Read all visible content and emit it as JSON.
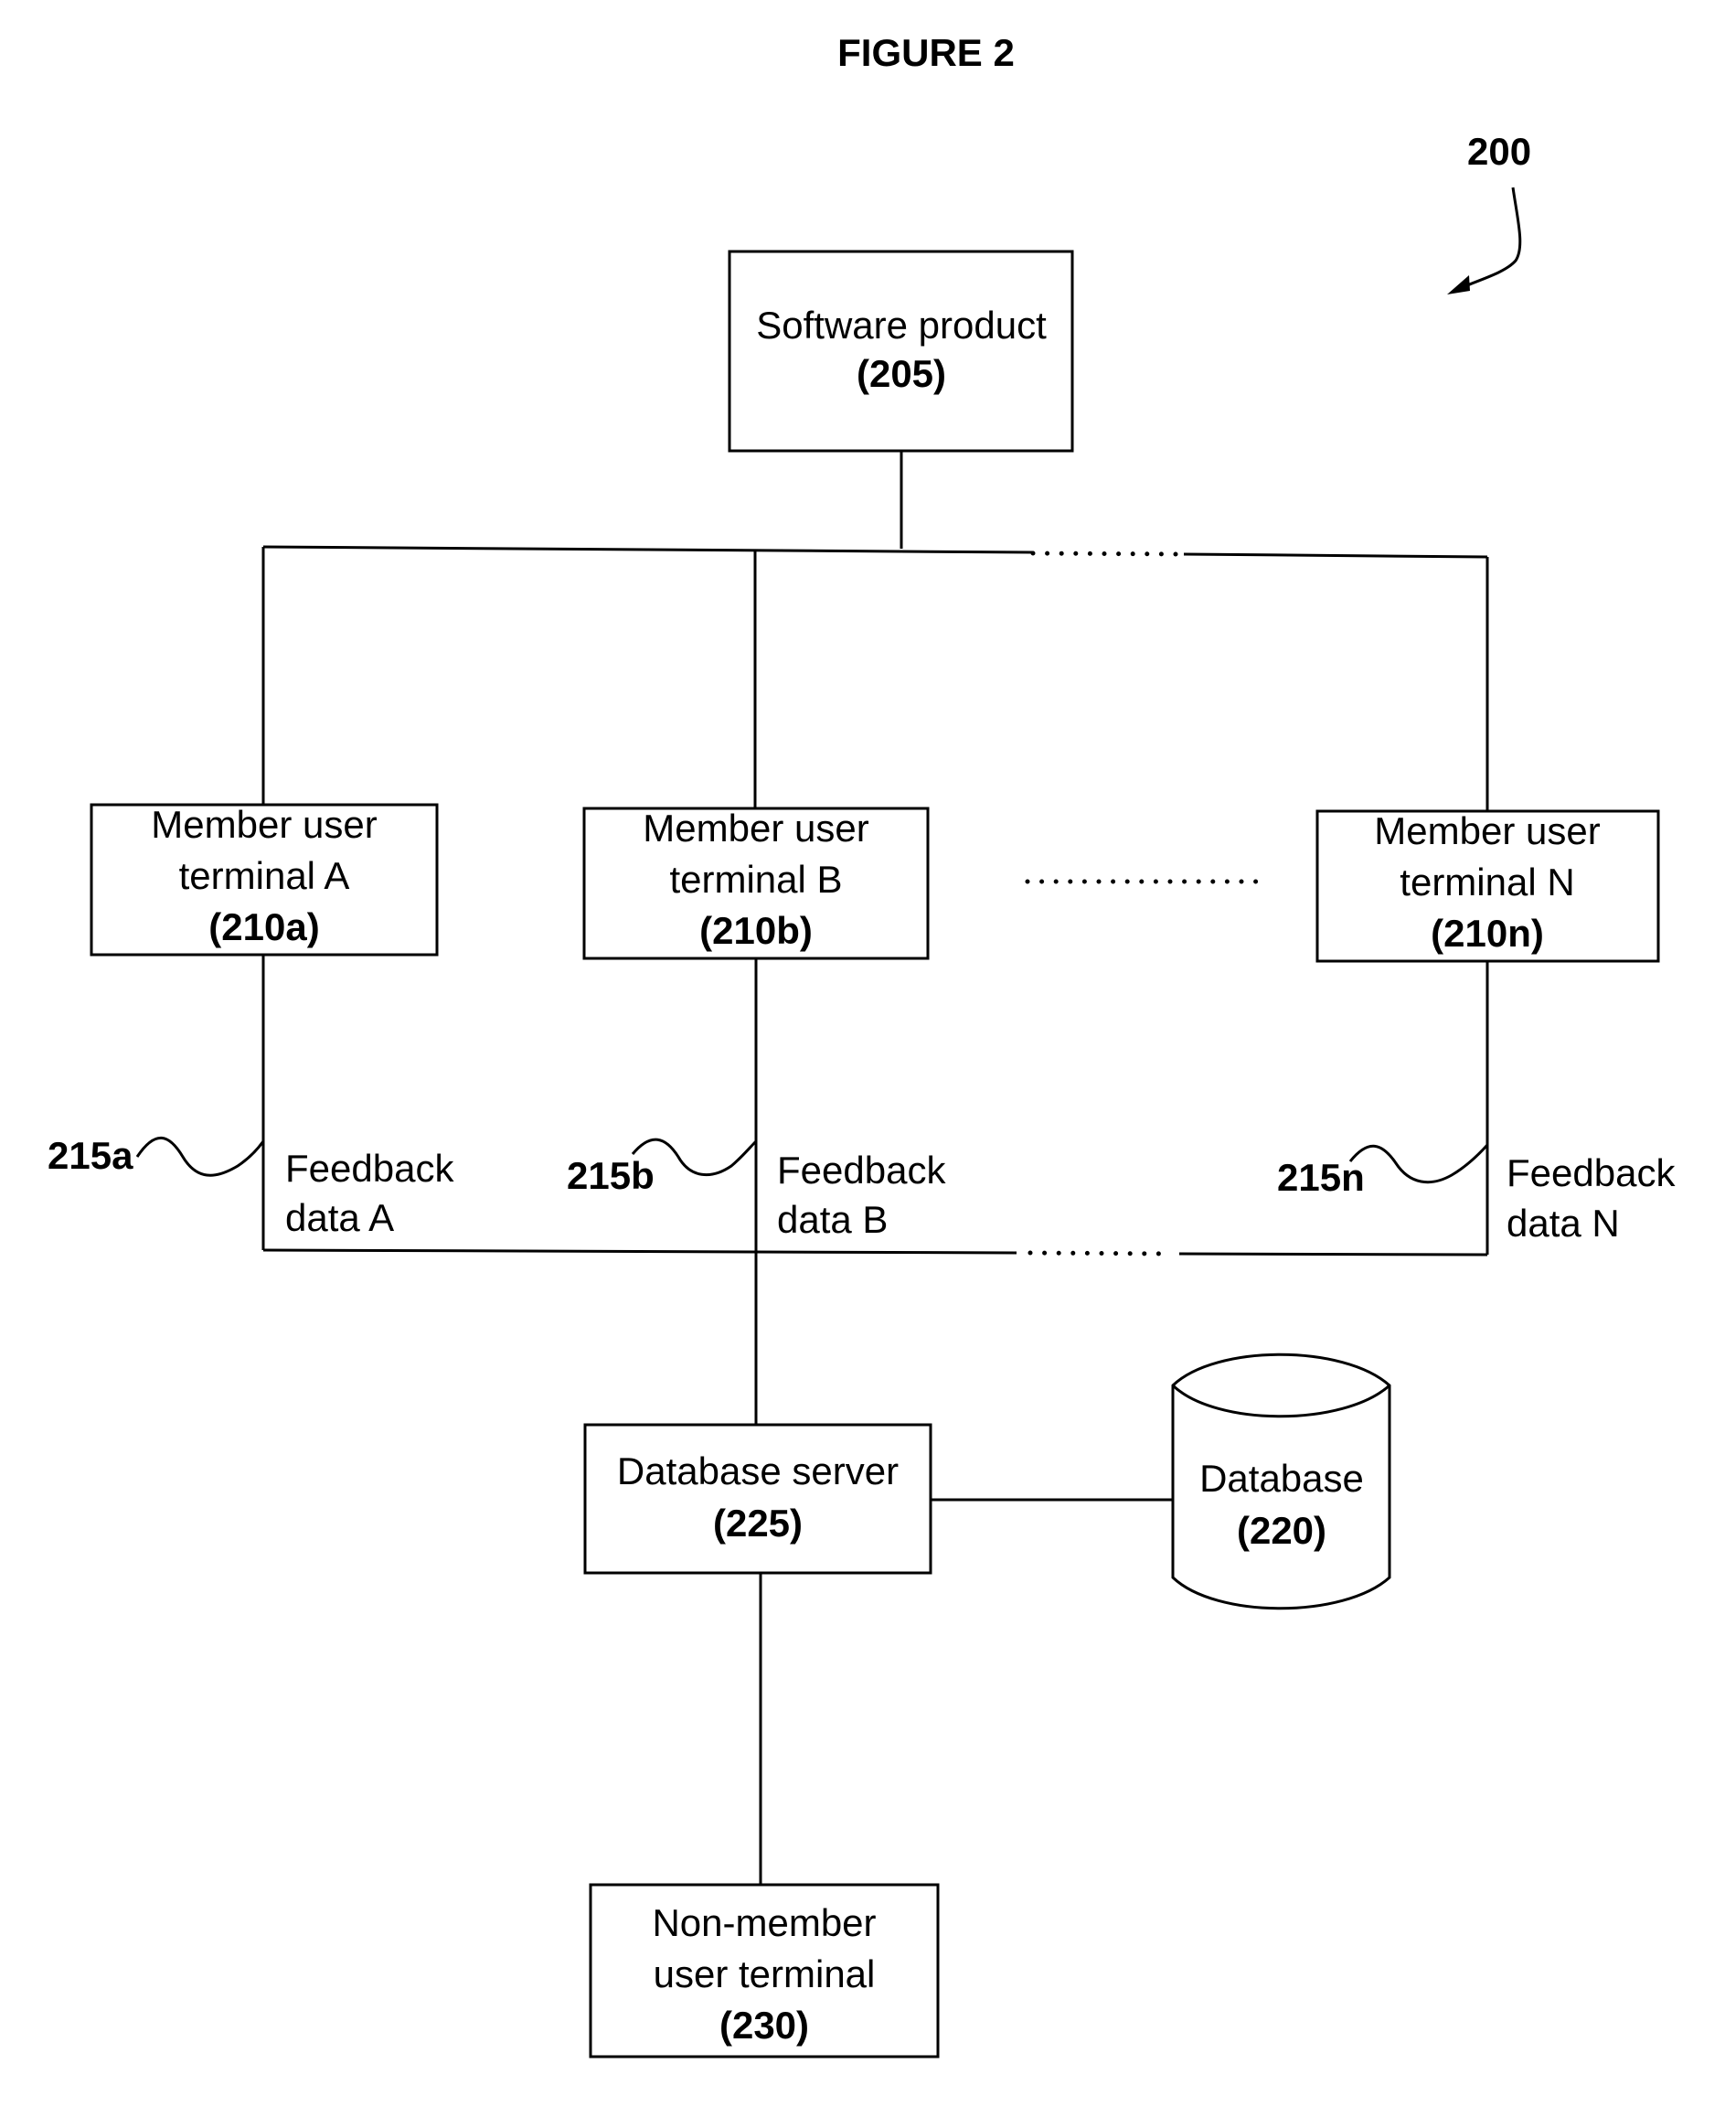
{
  "figure": {
    "title": "FIGURE 2",
    "reference": "200"
  },
  "nodes": {
    "software_product": {
      "line1": "Software product",
      "ref": "(205)"
    },
    "terminal_a": {
      "line1": "Member user",
      "line2": "terminal A",
      "ref": "(210a)"
    },
    "terminal_b": {
      "line1": "Member user",
      "line2": "terminal B",
      "ref": "(210b)"
    },
    "terminal_n": {
      "line1": "Member user",
      "line2": "terminal N",
      "ref": "(210n)"
    },
    "database_server": {
      "line1": "Database server",
      "ref": "(225)"
    },
    "database": {
      "line1": "Database",
      "ref": "(220)"
    },
    "non_member_terminal": {
      "line1": "Non-member",
      "line2": "user terminal",
      "ref": "(230)"
    }
  },
  "feedback": {
    "a": {
      "tag": "215a",
      "line1": "Feedback",
      "line2": "data A"
    },
    "b": {
      "tag": "215b",
      "line1": "Feedback",
      "line2": "data B"
    },
    "n": {
      "tag": "215n",
      "line1": "Feedback",
      "line2": "data N"
    }
  },
  "edges": [
    {
      "from": "software_product",
      "to": "terminal_a"
    },
    {
      "from": "software_product",
      "to": "terminal_b"
    },
    {
      "from": "software_product",
      "to": "terminal_n"
    },
    {
      "from": "terminal_a",
      "to": "database_server",
      "label": "feedback.a"
    },
    {
      "from": "terminal_b",
      "to": "database_server",
      "label": "feedback.b"
    },
    {
      "from": "terminal_n",
      "to": "database_server",
      "label": "feedback.n"
    },
    {
      "from": "database_server",
      "to": "database"
    },
    {
      "from": "database_server",
      "to": "non_member_terminal"
    }
  ]
}
